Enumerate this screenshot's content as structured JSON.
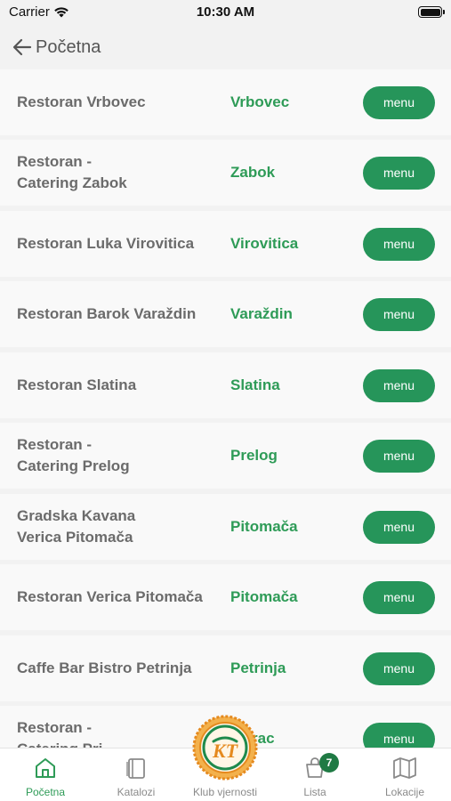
{
  "status": {
    "carrier": "Carrier",
    "time": "10:30 AM"
  },
  "nav": {
    "back_label": "Početna"
  },
  "restaurants": [
    {
      "name": "Restoran Vrbovec",
      "city": "Vrbovec",
      "menu_label": "menu"
    },
    {
      "name": "Restoran -\nCatering Zabok",
      "city": "Zabok",
      "menu_label": "menu"
    },
    {
      "name": "Restoran Luka Virovitica",
      "city": "Virovitica",
      "menu_label": "menu"
    },
    {
      "name": "Restoran Barok Varaždin",
      "city": "Varaždin",
      "menu_label": "menu"
    },
    {
      "name": "Restoran Slatina",
      "city": "Slatina",
      "menu_label": "menu"
    },
    {
      "name": "Restoran -\nCatering Prelog",
      "city": "Prelog",
      "menu_label": "menu"
    },
    {
      "name": "Gradska Kavana\nVerica Pitomača",
      "city": "Pitomača",
      "menu_label": "menu"
    },
    {
      "name": "Restoran Verica Pitomača",
      "city": "Pitomača",
      "menu_label": "menu"
    },
    {
      "name": "Caffe Bar Bistro Petrinja",
      "city": "Petrinja",
      "menu_label": "menu"
    },
    {
      "name": "Restoran -\nCatering Pri",
      "city": "rac",
      "menu_label": "menu"
    }
  ],
  "tabs": [
    {
      "label": "Početna",
      "icon": "home-icon",
      "active": true
    },
    {
      "label": "Katalozi",
      "icon": "catalog-icon",
      "active": false
    },
    {
      "label": "Klub vjernosti",
      "icon": "loyalty-club-logo",
      "active": false
    },
    {
      "label": "Lista",
      "icon": "shopping-list-icon",
      "active": false,
      "badge": "7"
    },
    {
      "label": "Lokacije",
      "icon": "map-icon",
      "active": false
    }
  ],
  "klub_logo_text": "KT",
  "colors": {
    "accent": "#26955a",
    "city_text": "#2e9b57",
    "badge": "#1f7a44",
    "logo_orange": "#e58a1f"
  }
}
